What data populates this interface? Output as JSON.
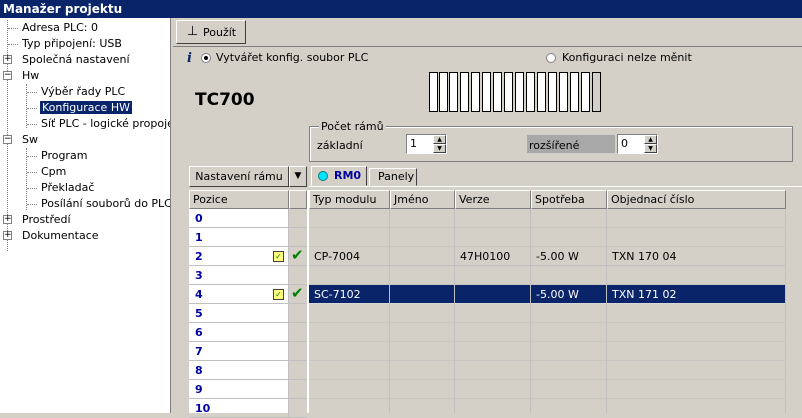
{
  "window": {
    "title": "Manažer projektu"
  },
  "tree": [
    {
      "label": "Adresa PLC: 0"
    },
    {
      "label": "Typ připojení: USB"
    },
    {
      "label": "Společná nastavení"
    },
    {
      "label": "Hw"
    },
    {
      "label": "Výběr řady PLC"
    },
    {
      "label": "Konfigurace HW"
    },
    {
      "label": "Síť PLC - logické propojení"
    },
    {
      "label": "Sw"
    },
    {
      "label": "Program"
    },
    {
      "label": "Cpm"
    },
    {
      "label": "Překladač"
    },
    {
      "label": "Posílání souborů do PLC"
    },
    {
      "label": "Prostředí"
    },
    {
      "label": "Dokumentace"
    }
  ],
  "toolbar": {
    "apply_label": "Použít"
  },
  "config": {
    "option_create": "Vytvářet konfig. soubor PLC",
    "option_locked": "Konfiguraci nelze měnit",
    "selected_option": "create",
    "plc_model": "TC700"
  },
  "frames": {
    "group_title": "Počet rámů",
    "basic_label": "základní",
    "basic_value": "1",
    "extended_label": "rozšířené",
    "extended_value": "0"
  },
  "grid": {
    "frame_settings_label": "Nastavení rámu",
    "tabs": [
      {
        "label": "RM0"
      },
      {
        "label": "Panely"
      }
    ],
    "active_tab": 0,
    "position_header": "Pozice",
    "columns": [
      "Typ modulu",
      "Jméno",
      "Verze",
      "Spotřeba",
      "Objednací číslo"
    ],
    "positions": [
      "0",
      "1",
      "2",
      "3",
      "4",
      "5",
      "6",
      "7",
      "8",
      "9",
      "10"
    ],
    "rows": [
      {
        "pos": "2",
        "checked": true,
        "selected": false,
        "cells": [
          "CP-7004",
          "",
          "47H0100",
          "-5.00 W",
          "TXN 170 04"
        ]
      },
      {
        "pos": "4",
        "checked": true,
        "selected": true,
        "cells": [
          "SC-7102",
          "",
          "",
          "-5.00 W",
          "TXN 171 02"
        ]
      }
    ]
  },
  "colors": {
    "selection": "#0a246a",
    "accent_text": "#0000a0",
    "check": "#008000",
    "radio_active": "#00e5ff"
  }
}
